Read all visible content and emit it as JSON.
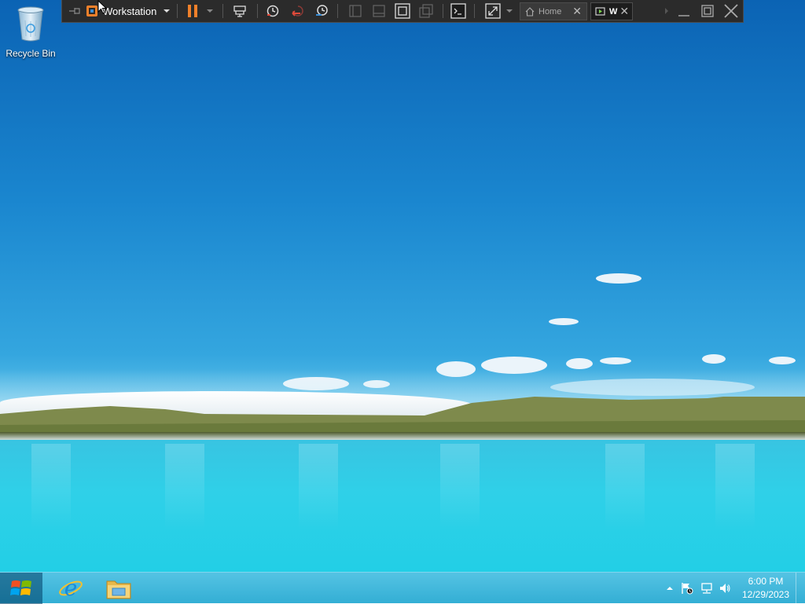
{
  "desktop": {
    "icons": [
      {
        "label": "Recycle Bin",
        "icon": "recycle-bin-icon"
      }
    ]
  },
  "vm_toolbar": {
    "title": "Workstation",
    "tabs": [
      {
        "label": "Home",
        "icon": "home-icon"
      },
      {
        "label": "W",
        "icon": "vm-icon"
      }
    ],
    "accent_color": "#f0802a"
  },
  "taskbar": {
    "pinned": [
      {
        "name": "Internet Explorer",
        "icon": "internet-explorer-icon"
      },
      {
        "name": "File Explorer",
        "icon": "file-explorer-icon"
      }
    ],
    "tray": {
      "time": "6:00 PM",
      "date": "12/29/2023"
    }
  }
}
